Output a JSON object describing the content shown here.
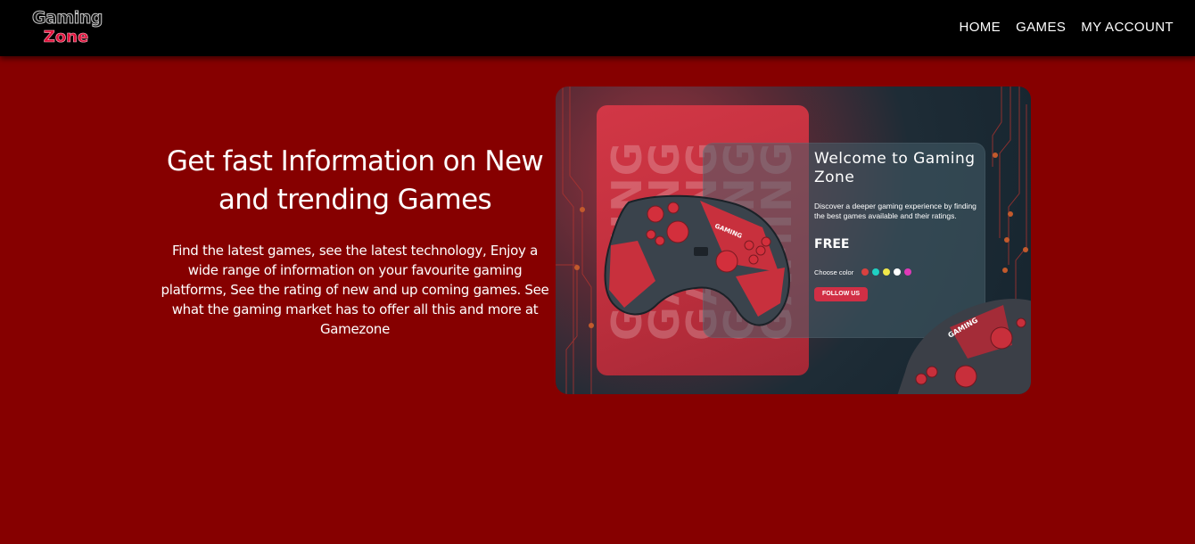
{
  "header": {
    "logo": {
      "line1": "Gaming",
      "line2": "Zone"
    },
    "nav": [
      {
        "label": "HOME"
      },
      {
        "label": "GAMES"
      },
      {
        "label": "MY ACCOUNT"
      }
    ]
  },
  "hero": {
    "title": "Get fast Information on New and trending Games",
    "description": "Find the latest games, see the latest technology, Enjoy a wide range of information on your favourite gaming platforms, See the rating of new and up coming games. See what the gaming market has to offer all this and more at Gamezone"
  },
  "promo_image": {
    "background_word": "GAMING",
    "controller_brand": "GAMING",
    "card": {
      "title": "Welcome to Gaming Zone",
      "description": "Discover a deeper gaming experience by finding the best games available and their ratings.",
      "price": "FREE",
      "choose_color_label": "Choose color",
      "colors": [
        "#d8413f",
        "#1fd1c3",
        "#f1e84a",
        "#ffffff",
        "#e03ab8"
      ],
      "button_label": "FOLLOW US"
    }
  },
  "colors": {
    "page_background": "#860000",
    "navbar_background": "#000000",
    "accent": "#d12f45"
  }
}
